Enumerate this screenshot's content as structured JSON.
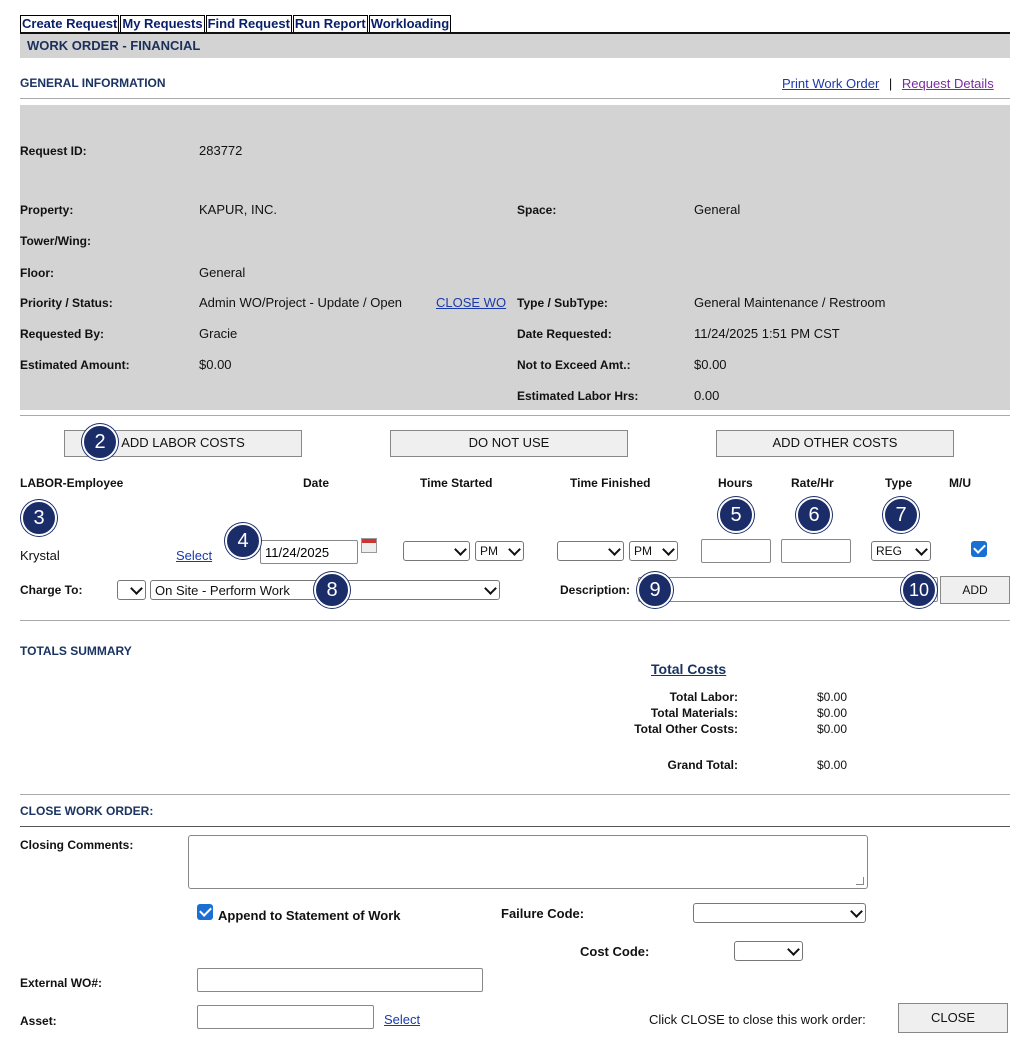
{
  "nav": [
    "Create Request",
    "My Requests",
    "Find Request",
    "Run Report",
    "Workloading"
  ],
  "page_title": "WORK ORDER - FINANCIAL",
  "general": {
    "heading": "GENERAL INFORMATION",
    "print_link": "Print Work Order",
    "separator": "|",
    "details_link": "Request Details"
  },
  "info": {
    "request_id_label": "Request ID:",
    "request_id": "283772",
    "property_label": "Property:",
    "property": "KAPUR, INC.",
    "space_label": "Space:",
    "space": "General",
    "tower_label": "Tower/Wing:",
    "floor_label": "Floor:",
    "floor": "General",
    "priority_label": "Priority / Status:",
    "priority": "Admin WO/Project - Update / Open",
    "close_wo_link": "CLOSE WO",
    "type_label": "Type / SubType:",
    "type": "General Maintenance / Restroom",
    "requested_by_label": "Requested By:",
    "requested_by": "Gracie",
    "date_requested_label": "Date Requested:",
    "date_requested": "11/24/2025 1:51 PM CST",
    "estimated_amount_label": "Estimated Amount:",
    "estimated_amount": "$0.00",
    "nte_label": "Not to Exceed Amt.:",
    "nte": "$0.00",
    "est_labor_label": "Estimated Labor Hrs:",
    "est_labor": "0.00"
  },
  "buttons": {
    "add_labor": "ADD LABOR COSTS",
    "do_not_use": "DO NOT USE",
    "add_other": "ADD OTHER COSTS",
    "add": "ADD",
    "close": "CLOSE"
  },
  "labor": {
    "col_employee": "LABOR-Employee",
    "col_date": "Date",
    "col_time_started": "Time Started",
    "col_time_finished": "Time Finished",
    "col_hours": "Hours",
    "col_rate": "Rate/Hr",
    "col_type": "Type",
    "col_mu": "M/U",
    "employee": "Krystal",
    "select_link": "Select",
    "date": "11/24/2025",
    "start_ampm": "PM",
    "finish_ampm": "PM",
    "type": "REG",
    "charge_label": "Charge To:",
    "charge_value": "On Site - Perform Work",
    "description_label": "Description:"
  },
  "badges": [
    "2",
    "3",
    "4",
    "5",
    "6",
    "7",
    "8",
    "9",
    "10"
  ],
  "totals": {
    "heading": "TOTALS SUMMARY",
    "total_costs_link": "Total Costs",
    "labor_label": "Total Labor:",
    "labor": "$0.00",
    "materials_label": "Total Materials:",
    "materials": "$0.00",
    "other_label": "Total Other Costs:",
    "other": "$0.00",
    "grand_label": "Grand Total:",
    "grand": "$0.00"
  },
  "close": {
    "heading": "CLOSE WORK ORDER:",
    "comments_label": "Closing Comments:",
    "append_label": "Append to Statement of Work",
    "failure_label": "Failure Code:",
    "cost_label": "Cost Code:",
    "external_label": "External WO#:",
    "asset_label": "Asset:",
    "select_link": "Select",
    "close_hint": "Click CLOSE to close this work order:"
  },
  "colors": {
    "badge": "#1b2d69",
    "header_text": "#1a3360",
    "grey_panel": "#d3d3d3",
    "link": "#1a3aa8",
    "checkbox": "#1a6fd4"
  }
}
